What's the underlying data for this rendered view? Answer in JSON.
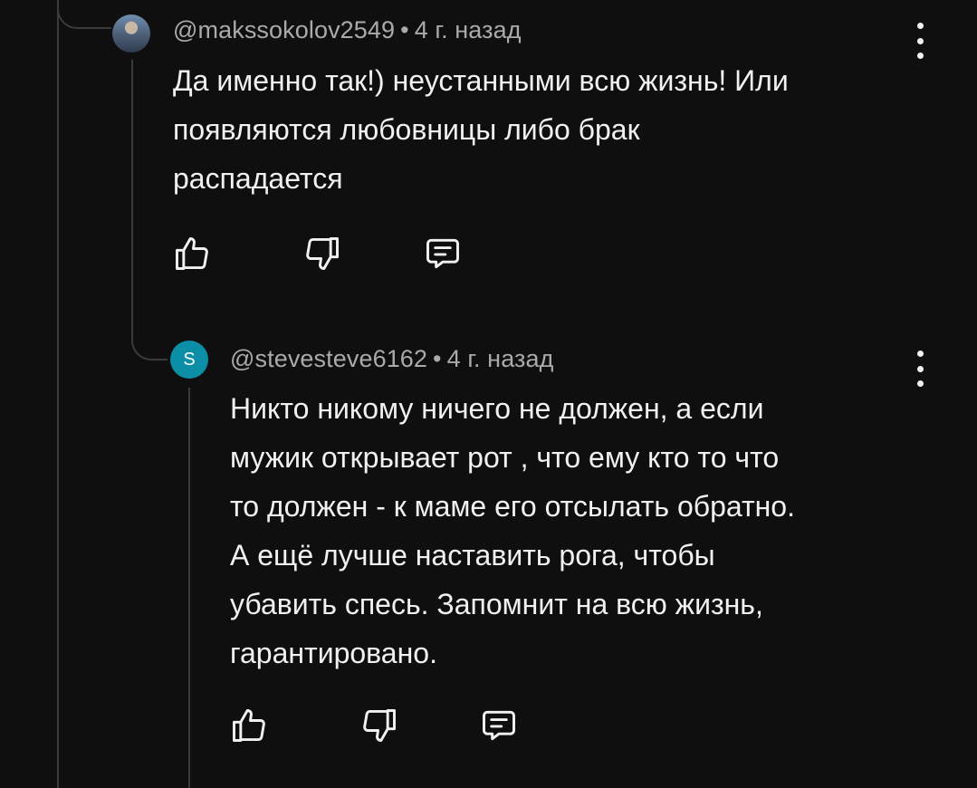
{
  "comments": [
    {
      "author": "@makssokolov2549",
      "separator": "•",
      "time": "4 г. назад",
      "avatar_letter": "",
      "lines": [
        "Да именно так!) неустанными всю жизнь! Или",
        "появляются любовницы либо брак",
        "распадается"
      ]
    },
    {
      "author": "@stevesteve6162",
      "separator": "•",
      "time": "4 г. назад",
      "avatar_letter": "S",
      "lines": [
        "Никто никому ничего не должен, а если",
        "мужик открывает рот , что ему кто то что",
        "то должен - к маме его отсылать обратно.",
        "А ещё лучше наставить рога, чтобы",
        "убавить спесь. Запомнит на всю жизнь,",
        "гарантировано."
      ]
    }
  ],
  "icons": {
    "like": "thumbs-up-icon",
    "dislike": "thumbs-down-icon",
    "reply": "reply-comment-icon",
    "more": "more-vertical-icon"
  },
  "colors": {
    "background": "#0f0f0f",
    "text": "#f1f1f1",
    "secondary_text": "#aaaaaa",
    "thread_line": "#3a3a3a",
    "avatar_accent": "#0c8ea6"
  }
}
